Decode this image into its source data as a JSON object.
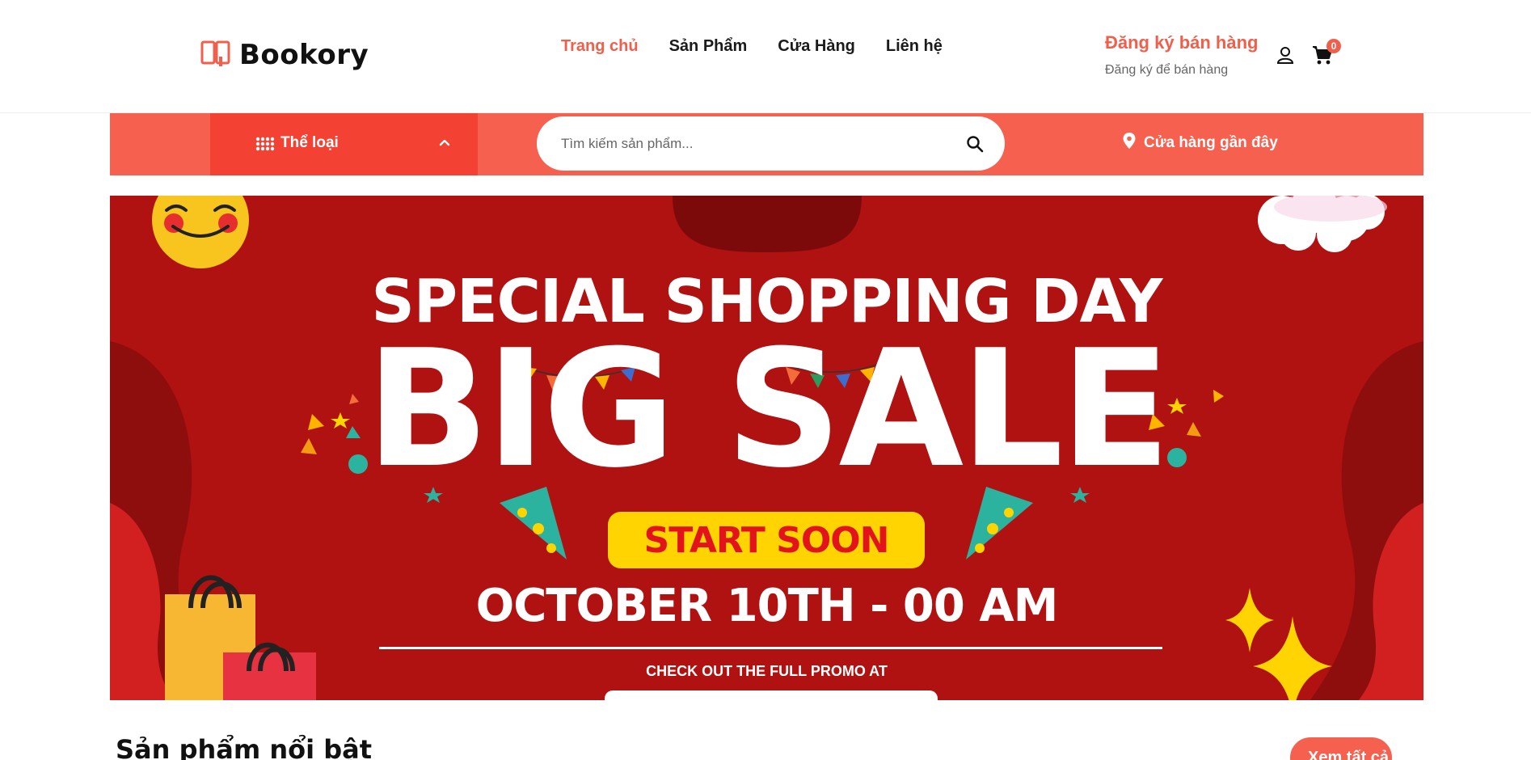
{
  "header": {
    "logo_text": "Bookory",
    "nav": [
      {
        "label": "Trang chủ",
        "active": true
      },
      {
        "label": "Sản Phẩm",
        "active": false
      },
      {
        "label": "Cửa Hàng",
        "active": false
      },
      {
        "label": "Liên hệ",
        "active": false
      }
    ],
    "seller_title": "Đăng ký bán hàng",
    "seller_subtitle": "Đăng ký để bán hàng",
    "cart_count": "0"
  },
  "toolbar": {
    "category_label": "Thể loại",
    "search_placeholder": "Tìm kiếm sản phẩm...",
    "nearby_store_label": "Cửa hàng gần đây"
  },
  "banner": {
    "headline": "SPECIAL SHOPPING DAY",
    "big_text": "BIG SALE",
    "cta": "START SOON",
    "date": "OCTOBER 10TH - 00 AM",
    "note": "CHECK OUT THE FULL PROMO AT"
  },
  "section": {
    "title": "Sản phẩm nổi bật",
    "see_more": "Xem tất cả"
  },
  "colors": {
    "accent": "#f05f4b",
    "band": "#f6604f",
    "category_bg": "#f34233",
    "banner_bg": "#b01111",
    "cta_bg": "#ffd400"
  },
  "icons": [
    "book-logo-icon",
    "user-icon",
    "cart-icon",
    "grid-icon",
    "chevron-up-icon",
    "search-icon",
    "location-pin-icon"
  ]
}
